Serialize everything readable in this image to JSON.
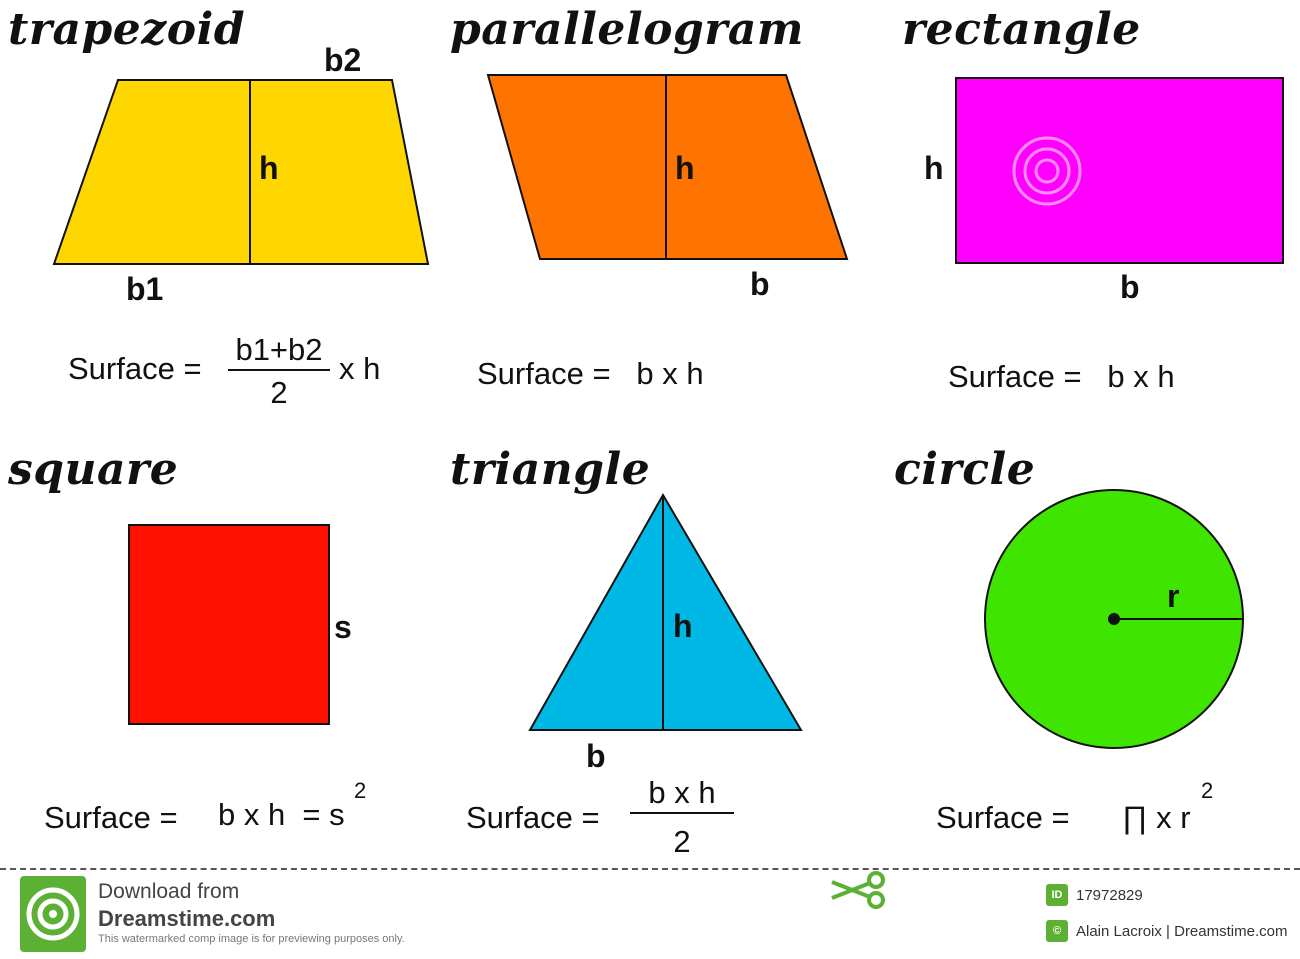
{
  "shapes": {
    "trapezoid": {
      "title": "trapezoid",
      "b2": "b2",
      "h": "h",
      "b1": "b1",
      "formula_prefix": "Surface =",
      "numerator": "b1+b2",
      "denominator": "2",
      "suffix": "x h",
      "color": "#ffd700"
    },
    "parallelogram": {
      "title": "parallelogram",
      "h": "h",
      "b": "b",
      "formula": "Surface =   b x h",
      "color": "#ff7300"
    },
    "rectangle": {
      "title": "rectangle",
      "h": "h",
      "b": "b",
      "formula": "Surface =   b x h",
      "color": "#ff00ff"
    },
    "square": {
      "title": "square",
      "s": "s",
      "formula_prefix": "Surface =",
      "formula_mid": "b x h  = s",
      "exponent": "2",
      "color": "#ff1100"
    },
    "triangle": {
      "title": "triangle",
      "h": "h",
      "b": "b",
      "formula_prefix": "Surface =",
      "numerator": "b x h",
      "denominator": "2",
      "color": "#00b8e6"
    },
    "circle": {
      "title": "circle",
      "r": "r",
      "formula_prefix": "Surface =",
      "formula_mid": "∏ x r",
      "exponent": "2",
      "color": "#3fe500"
    }
  },
  "footer": {
    "download_line": "Download from",
    "brand": "Dreamstime.com",
    "disclaimer": "This watermarked comp image is for previewing purposes only.",
    "id_badge": "ID",
    "image_id": "17972829",
    "copyright_badge": "©",
    "credit": "Alain Lacroix | Dreamstime.com",
    "logo_icon": "dreamstime-spiral-logo-icon",
    "cut_icon": "scissors-icon",
    "accent": "#5cb135"
  }
}
